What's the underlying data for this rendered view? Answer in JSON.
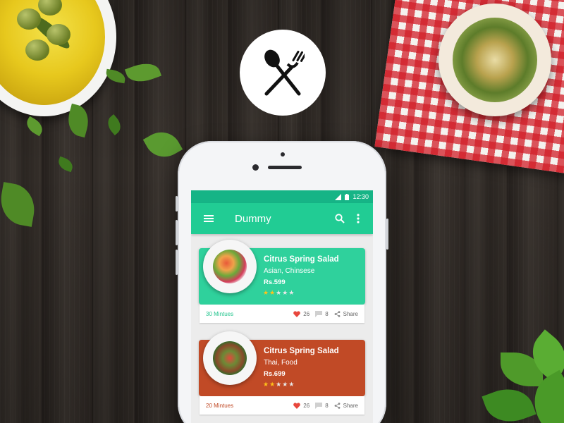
{
  "status_bar": {
    "time": "12:30"
  },
  "app_bar": {
    "title": "Dummy"
  },
  "cards": [
    {
      "name": "Citrus Spring Salad",
      "cuisine": "Asian, Chinsese",
      "price": "Rs.599",
      "rating": 2,
      "rating_max": 5,
      "time": "30 Mintues",
      "likes": "26",
      "comments": "8",
      "share_label": "Share",
      "color": "#2fd19c"
    },
    {
      "name": "Citrus Spring Salad",
      "cuisine": "Thai, Food",
      "price": "Rs.699",
      "rating": 2,
      "rating_max": 5,
      "time": "20 Mintues",
      "likes": "26",
      "comments": "8",
      "share_label": "Share",
      "color": "#c14a26"
    }
  ],
  "colors": {
    "status_bar": "#16b486",
    "app_bar": "#21cc94",
    "star": "#ffc21a",
    "heart": "#e8473d"
  },
  "icons": [
    "utensils-icon",
    "menu-icon",
    "search-icon",
    "more-vert-icon",
    "heart-icon",
    "comment-icon",
    "share-icon",
    "signal-icon",
    "battery-icon"
  ]
}
